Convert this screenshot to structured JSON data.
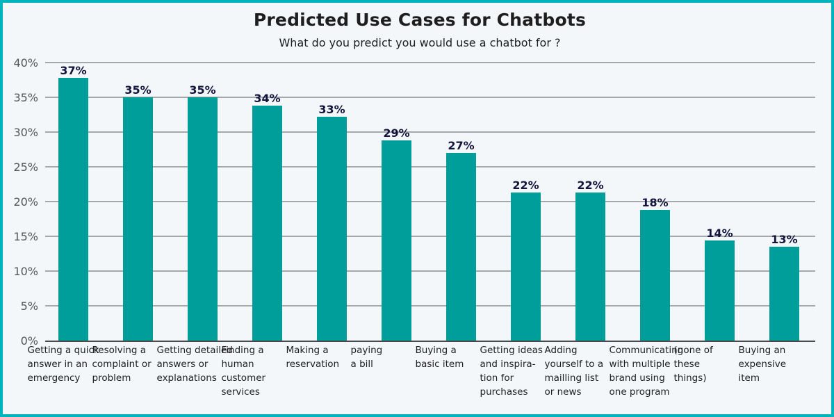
{
  "chart_data": {
    "type": "bar",
    "title": "Predicted Use Cases for Chatbots",
    "subtitle": "What do you predict you would use a chatbot for ?",
    "xlabel": "",
    "ylabel": "",
    "ylim": [
      0,
      40
    ],
    "yticks": [
      "0%",
      "5%",
      "10%",
      "15%",
      "20%",
      "25%",
      "30%",
      "35%",
      "40%"
    ],
    "ytick_values": [
      0,
      5,
      10,
      15,
      20,
      25,
      30,
      35,
      40
    ],
    "grid": true,
    "legend": "none",
    "categories": [
      "Getting a quick\nanswer in an\nemergency",
      "Resolving a\ncomplaint or\nproblem",
      "Getting detailed\nanswers or\nexplanations",
      "Finding a\nhuman\ncustomer\nservices",
      "Making a\nreservation",
      "paying\na bill",
      "Buying a\nbasic item",
      "Getting ideas\n and inspira-\ntion for\npurchases",
      "Adding\nyourself to a\nmailling list\nor news",
      "Communicating\nwith multiple\nbrand using\none program",
      "(none of\nthese\nthings)",
      "Buying an\nexpensive\nitem"
    ],
    "values": [
      37.8,
      35,
      35,
      33.8,
      32.2,
      28.8,
      27,
      21.3,
      21.3,
      18.8,
      14.4,
      13.5
    ],
    "data_labels": [
      "37%",
      "35%",
      "35%",
      "34%",
      "33%",
      "29%",
      "27%",
      "22%",
      "22%",
      "18%",
      "14%",
      "13%"
    ]
  },
  "colors": {
    "bar": "#009e9a",
    "border": "#00b5bd",
    "background": "#f3f7fa",
    "grid": "#7a7a7a",
    "axis": "#111111"
  }
}
